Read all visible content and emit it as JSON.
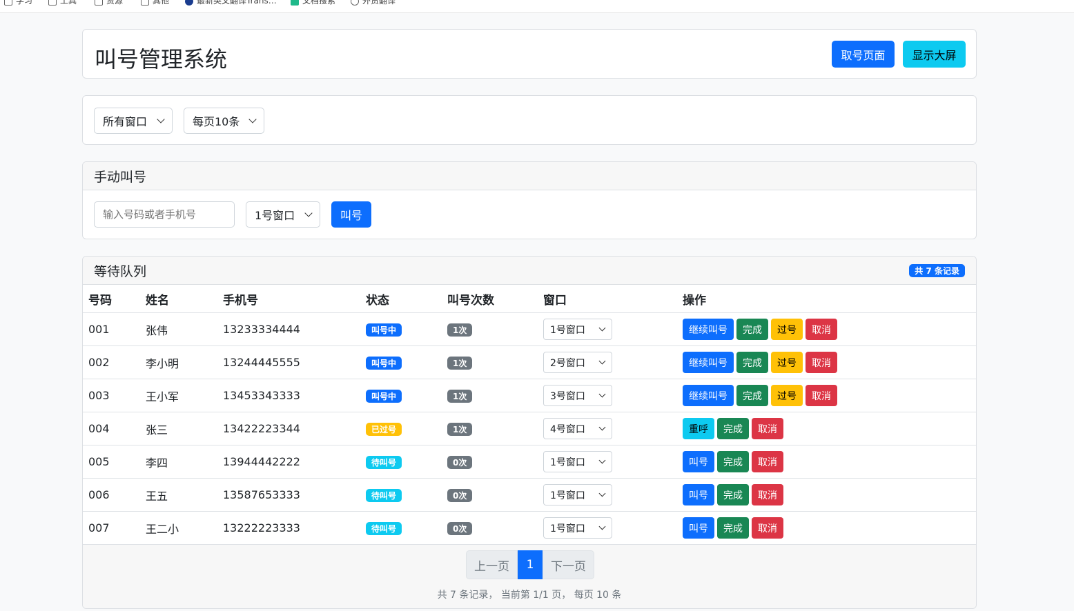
{
  "bookmarks": [
    "学习",
    "工具",
    "资源",
    "其他",
    "最新英文翻译Trans…",
    "文档搜索",
    "外贸翻译"
  ],
  "header": {
    "title": "叫号管理系统",
    "take_number_label": "取号页面",
    "show_screen_label": "显示大屏"
  },
  "filters": {
    "window_select": "所有窗口",
    "page_size_select": "每页10条"
  },
  "manual": {
    "title": "手动叫号",
    "input_placeholder": "输入号码或者手机号",
    "window_select": "1号窗口",
    "call_label": "叫号"
  },
  "queue": {
    "title": "等待队列",
    "total_badge": "共 7 条记录",
    "columns": [
      "号码",
      "姓名",
      "手机号",
      "状态",
      "叫号次数",
      "窗口",
      "操作"
    ],
    "rows": [
      {
        "number": "001",
        "name": "张伟",
        "phone": "13233334444",
        "status": "叫号中",
        "status_type": "calling",
        "count": "1次",
        "window": "1号窗口",
        "actions": [
          {
            "label": "继续叫号",
            "type": "primary"
          },
          {
            "label": "完成",
            "type": "success"
          },
          {
            "label": "过号",
            "type": "warning"
          },
          {
            "label": "取消",
            "type": "danger"
          }
        ]
      },
      {
        "number": "002",
        "name": "李小明",
        "phone": "13244445555",
        "status": "叫号中",
        "status_type": "calling",
        "count": "1次",
        "window": "2号窗口",
        "actions": [
          {
            "label": "继续叫号",
            "type": "primary"
          },
          {
            "label": "完成",
            "type": "success"
          },
          {
            "label": "过号",
            "type": "warning"
          },
          {
            "label": "取消",
            "type": "danger"
          }
        ]
      },
      {
        "number": "003",
        "name": "王小军",
        "phone": "13453343333",
        "status": "叫号中",
        "status_type": "calling",
        "count": "1次",
        "window": "3号窗口",
        "actions": [
          {
            "label": "继续叫号",
            "type": "primary"
          },
          {
            "label": "完成",
            "type": "success"
          },
          {
            "label": "过号",
            "type": "warning"
          },
          {
            "label": "取消",
            "type": "danger"
          }
        ]
      },
      {
        "number": "004",
        "name": "张三",
        "phone": "13422223344",
        "status": "已过号",
        "status_type": "passed",
        "count": "1次",
        "window": "4号窗口",
        "actions": [
          {
            "label": "重呼",
            "type": "info"
          },
          {
            "label": "完成",
            "type": "success"
          },
          {
            "label": "取消",
            "type": "danger"
          }
        ]
      },
      {
        "number": "005",
        "name": "李四",
        "phone": "13944442222",
        "status": "待叫号",
        "status_type": "waiting",
        "count": "0次",
        "window": "1号窗口",
        "actions": [
          {
            "label": "叫号",
            "type": "primary"
          },
          {
            "label": "完成",
            "type": "success"
          },
          {
            "label": "取消",
            "type": "danger"
          }
        ]
      },
      {
        "number": "006",
        "name": "王五",
        "phone": "13587653333",
        "status": "待叫号",
        "status_type": "waiting",
        "count": "0次",
        "window": "1号窗口",
        "actions": [
          {
            "label": "叫号",
            "type": "primary"
          },
          {
            "label": "完成",
            "type": "success"
          },
          {
            "label": "取消",
            "type": "danger"
          }
        ]
      },
      {
        "number": "007",
        "name": "王二小",
        "phone": "13222223333",
        "status": "待叫号",
        "status_type": "waiting",
        "count": "0次",
        "window": "1号窗口",
        "actions": [
          {
            "label": "叫号",
            "type": "primary"
          },
          {
            "label": "完成",
            "type": "success"
          },
          {
            "label": "取消",
            "type": "danger"
          }
        ]
      }
    ]
  },
  "pagination": {
    "prev_label": "上一页",
    "current_page": "1",
    "next_label": "下一页",
    "info": "共 7 条记录， 当前第 1/1 页， 每页 10 条"
  },
  "colors": {
    "primary": "#0d6efd",
    "info": "#0dcaf0",
    "success": "#198754",
    "warning": "#ffc107",
    "danger": "#dc3545",
    "secondary": "#6c757d"
  },
  "icons": {
    "bookmark": "bookmark-icon",
    "chevron": "chevron-down-icon"
  }
}
